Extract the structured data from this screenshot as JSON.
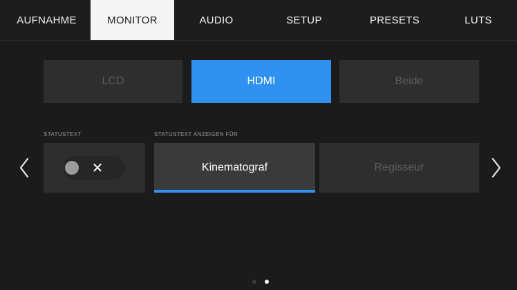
{
  "tabs": [
    {
      "label": "AUFNAHME",
      "active": false
    },
    {
      "label": "MONITOR",
      "active": true
    },
    {
      "label": "AUDIO",
      "active": false
    },
    {
      "label": "SETUP",
      "active": false
    },
    {
      "label": "PRESETS",
      "active": false
    },
    {
      "label": "LUTS",
      "active": false
    }
  ],
  "output": {
    "options": [
      "LCD",
      "HDMI",
      "Beide"
    ],
    "selected": "HDMI"
  },
  "status_text": {
    "label": "STATUSTEXT",
    "toggle_symbol": "✕",
    "enabled": false
  },
  "display_for": {
    "label": "STATUSTEXT ANZEIGEN FÜR",
    "options": [
      "Kinematograf",
      "Regisseur"
    ],
    "selected": "Kinematograf"
  },
  "navigation": {
    "prev_icon": "chevron-left-icon",
    "next_icon": "chevron-right-icon"
  },
  "pagination": {
    "total": 2,
    "current": 2
  },
  "colors": {
    "accent": "#2f91f0",
    "background": "#1b1b1b",
    "button": "#2e2e2e",
    "tab_active": "#f4f4f4"
  }
}
